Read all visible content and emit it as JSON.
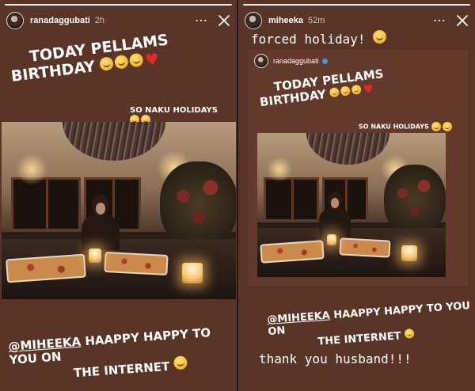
{
  "left_story": {
    "username": "ranadaggubati",
    "timestamp": "2h",
    "more_label": "⋯",
    "caption_line1": "Today Pellams",
    "caption_line2": "Birthday",
    "holidays_text": "So naku holidays",
    "mention_handle": "@Miheeka",
    "mention_text": "Haappy happy to you on",
    "mention_line2": "the internet"
  },
  "right_story": {
    "username": "miheeka",
    "timestamp": "52m",
    "more_label": "⋯",
    "top_text": "forced holiday!",
    "quoted_username": "ranadaggubati",
    "bottom_text": "thank you husband!!!"
  },
  "icons": {
    "close": "close-icon",
    "more": "more-icon",
    "emoji": "grinning-emoji",
    "heart": "red-heart"
  },
  "colors": {
    "story_background": "#5a3527",
    "heart": "#e0282e",
    "verified": "#3897f0"
  }
}
